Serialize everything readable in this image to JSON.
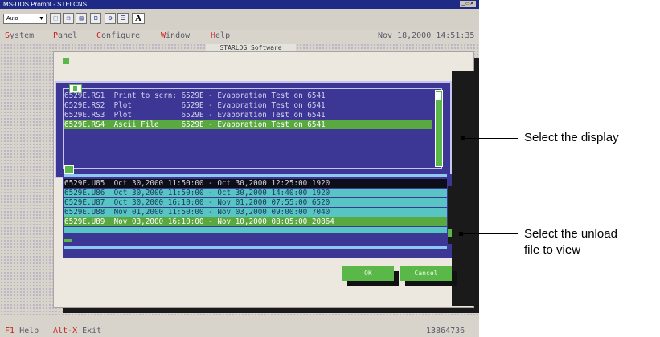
{
  "window": {
    "title": "MS-DOS Prompt - STELCNS",
    "font_size_value": "Auto"
  },
  "toolbar": {
    "font_button_label": "A"
  },
  "menu": {
    "items": [
      {
        "hot": "S",
        "rest": "ystem"
      },
      {
        "hot": "P",
        "rest": "anel"
      },
      {
        "hot": "C",
        "rest": "onfigure"
      },
      {
        "hot": "W",
        "rest": "indow"
      },
      {
        "hot": "H",
        "rest": "elp"
      }
    ],
    "datetime": "Nov 18,2000 14:51:35"
  },
  "app_title": "STARLOG Software",
  "display_list": {
    "rows": [
      {
        "file": "6529E.RS1",
        "type": "Print to scrn:",
        "desc": "6529E - Evaporation Test on 6541"
      },
      {
        "file": "6529E.RS2",
        "type": "Plot",
        "desc": "6529E - Evaporation Test on 6541"
      },
      {
        "file": "6529E.RS3",
        "type": "Plot",
        "desc": "6529E - Evaporation Test on 6541"
      },
      {
        "file": "6529E.RS4",
        "type": "Ascii File",
        "desc": "6529E - Evaporation Test on 6541"
      }
    ],
    "selected_index": 3
  },
  "unload_list": {
    "rows": [
      {
        "file": "6529E.U85",
        "range": "Oct 30,2000 11:50:00 - Oct 30,2000 12:25:00",
        "count": "1920"
      },
      {
        "file": "6529E.U86",
        "range": "Oct 30,2000 11:50:00 - Oct 30,2000 14:40:00",
        "count": "1920"
      },
      {
        "file": "6529E.U87",
        "range": "Oct 30,2000 16:10:00 - Nov 01,2000 07:55:00",
        "count": "6520"
      },
      {
        "file": "6529E.U88",
        "range": "Nov 01,2000 11:50:00 - Nov 03,2000 09:00:00",
        "count": "7040"
      },
      {
        "file": "6529E.U89",
        "range": "Nov 03,2000 16:10:00 - Nov 10,2000 08:05:00",
        "count": "20864"
      }
    ],
    "selected_index": 4
  },
  "buttons": {
    "ok": "OK",
    "cancel": "Cancel"
  },
  "footer": {
    "f1_key": "F1",
    "f1_label": "Help",
    "altx_key": "Alt-X",
    "altx_label": "Exit",
    "memory": "13864736"
  },
  "callouts": {
    "display": "Select the display",
    "unload_line1": "Select the unload",
    "unload_line2": "file to view"
  }
}
